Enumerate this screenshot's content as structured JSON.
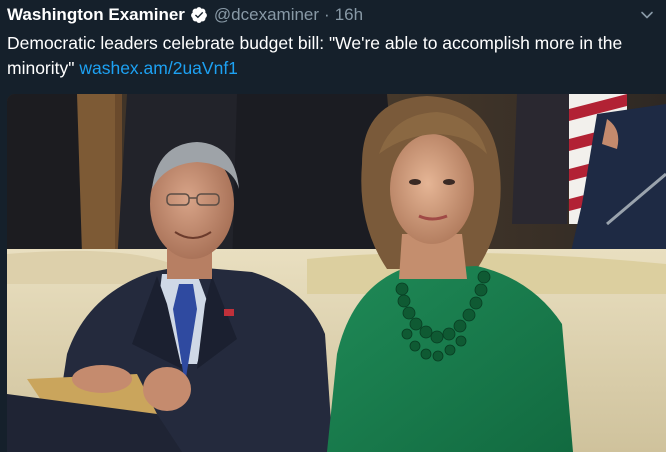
{
  "tweet": {
    "display_name": "Washington Examiner",
    "handle": "@dcexaminer",
    "separator": "·",
    "time": "16h",
    "text": "Democratic leaders celebrate budget bill: \"We're able to accomplish more in the minority\" ",
    "link": "washex.am/2uaVnf1"
  },
  "colors": {
    "background": "#15202b",
    "text": "#ffffff",
    "muted": "#8899a6",
    "link": "#1da1f2",
    "verified": "#ffffff"
  },
  "icons": {
    "verified": "verified-badge-icon",
    "more": "chevron-down-icon"
  }
}
